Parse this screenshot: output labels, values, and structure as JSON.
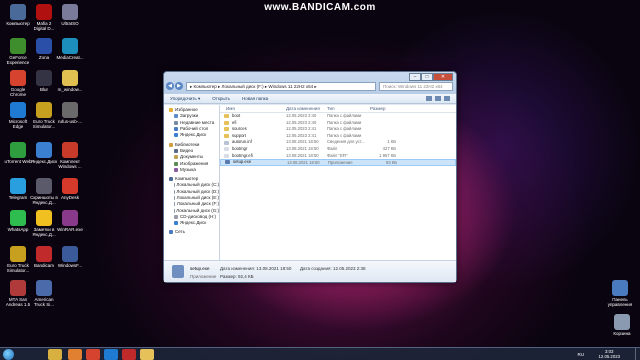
{
  "watermark": "www.BANDICAM.com",
  "desktop_icons_left": [
    {
      "label": "Компьютер",
      "icon": "computer-icon",
      "color": "#4a6a9a"
    },
    {
      "label": "Mafia 2 Digital D...",
      "icon": "game-icon",
      "color": "#b01010"
    },
    {
      "label": "UltraISO",
      "icon": "disc-icon",
      "color": "#7a7a9a"
    },
    {
      "label": "GeForce Experience",
      "icon": "nvidia-icon",
      "color": "#3e8e2e"
    },
    {
      "label": "Zona",
      "icon": "zona-icon",
      "color": "#2a4fa8"
    },
    {
      "label": "MediaCreat...",
      "icon": "media-icon",
      "color": "#1c8fbd"
    },
    {
      "label": "Google Chrome",
      "icon": "chrome-icon",
      "color": "#d6432f"
    },
    {
      "label": "Blur",
      "icon": "game-icon",
      "color": "#333344"
    },
    {
      "label": "m_window...",
      "icon": "folder-icon",
      "color": "#e0c050"
    },
    {
      "label": "Microsoft Edge",
      "icon": "edge-icon",
      "color": "#1f7bd1"
    },
    {
      "label": "Euro Truck Simulator...",
      "icon": "truck-icon",
      "color": "#c8a020"
    },
    {
      "label": "rufus-usb-...",
      "icon": "usb-icon",
      "color": "#6a6a6a"
    },
    {
      "label": "uTorrent Web",
      "icon": "utorrent-icon",
      "color": "#2e9e3e"
    },
    {
      "label": "Яндекс.Диск",
      "icon": "yadisk-icon",
      "color": "#3a7fd0"
    },
    {
      "label": "Комплект Windows ...",
      "icon": "windows-icon",
      "color": "#c83a2a"
    },
    {
      "label": "Telegram",
      "icon": "telegram-icon",
      "color": "#2a9fe0"
    },
    {
      "label": "Скриншоты в Яндекс.Д...",
      "icon": "scissors-icon",
      "color": "#5a5a6a"
    },
    {
      "label": "AnyDesk",
      "icon": "anydesk-icon",
      "color": "#d63a2a"
    },
    {
      "label": "WhatsApp",
      "icon": "whatsapp-icon",
      "color": "#2ebd4e"
    },
    {
      "label": "Заметки в Яндекс.Д...",
      "icon": "notes-icon",
      "color": "#f0c020"
    },
    {
      "label": "WinRAR.exe",
      "icon": "winrar-icon",
      "color": "#8a3a8a"
    },
    {
      "label": "Euro Truck Simulator...",
      "icon": "truck-icon",
      "color": "#c8a020"
    },
    {
      "label": "Bandicam",
      "icon": "bandicam-icon",
      "color": "#c02a2a"
    },
    {
      "label": "WindowsF...",
      "icon": "windows-icon",
      "color": "#3a5a9a"
    },
    {
      "label": "MTA San Andreas 1.5",
      "icon": "mta-icon",
      "color": "#b03a3a"
    },
    {
      "label": "American Truck Si...",
      "icon": "truck-icon",
      "color": "#4a6aaa"
    }
  ],
  "desktop_icons_right": [
    {
      "label": "Панель управления",
      "icon": "control-panel-icon",
      "color": "#4a7ac0"
    },
    {
      "label": "Корзина",
      "icon": "recycle-bin-icon",
      "color": "#8a9ab0"
    }
  ],
  "window": {
    "address": "▸ Компьютер ▸ Локальный диск (F:) ▸ Windows 11 22H2 x64 ▸",
    "search_placeholder": "Поиск: Windows 11 22H2 x64",
    "toolbar": {
      "organize": "Упорядочить ▾",
      "open": "Открыть",
      "new_folder": "Новая папка"
    },
    "columns": {
      "name": "Имя",
      "date": "Дата изменения",
      "type": "Тип",
      "size": "Размер"
    },
    "sidebar": [
      {
        "label": "Избранное",
        "icon": "star-icon",
        "color": "#e8b030",
        "level": 0
      },
      {
        "label": "Загрузки",
        "icon": "downloads-icon",
        "color": "#5a8ad0",
        "level": 1
      },
      {
        "label": "Недавние места",
        "icon": "recent-icon",
        "color": "#7a8aa0",
        "level": 1
      },
      {
        "label": "Рабочий стол",
        "icon": "desktop-icon",
        "color": "#4a7ac0",
        "level": 1
      },
      {
        "label": "Яндекс.Диск",
        "icon": "yadisk-icon",
        "color": "#3a7fd0",
        "level": 1
      },
      {
        "label": "",
        "icon": "",
        "color": "",
        "level": -1
      },
      {
        "label": "Библиотеки",
        "icon": "library-icon",
        "color": "#d0a040",
        "level": 0
      },
      {
        "label": "Видео",
        "icon": "video-icon",
        "color": "#5a6a8a",
        "level": 1
      },
      {
        "label": "Документы",
        "icon": "documents-icon",
        "color": "#c0a050",
        "level": 1
      },
      {
        "label": "Изображения",
        "icon": "pictures-icon",
        "color": "#5a8a5a",
        "level": 1
      },
      {
        "label": "Музыка",
        "icon": "music-icon",
        "color": "#8a5aa0",
        "level": 1
      },
      {
        "label": "",
        "icon": "",
        "color": "",
        "level": -1
      },
      {
        "label": "Компьютер",
        "icon": "computer-icon",
        "color": "#4a6a9a",
        "level": 0
      },
      {
        "label": "Локальный диск (C:)",
        "icon": "drive-icon",
        "color": "#8a9aaa",
        "level": 1
      },
      {
        "label": "Локальный диск (D:)",
        "icon": "drive-icon",
        "color": "#8a9aaa",
        "level": 1
      },
      {
        "label": "Локальный диск (E:)",
        "icon": "drive-icon",
        "color": "#8a9aaa",
        "level": 1
      },
      {
        "label": "Локальный диск (F:)",
        "icon": "drive-icon",
        "color": "#8a9aaa",
        "level": 1
      },
      {
        "label": "Локальный диск (G:)",
        "icon": "drive-icon",
        "color": "#8a9aaa",
        "level": 1
      },
      {
        "label": "CD-дисковод (H:)",
        "icon": "cd-icon",
        "color": "#9a9aaa",
        "level": 1
      },
      {
        "label": "Яндекс.Диск",
        "icon": "yadisk-icon",
        "color": "#3a7fd0",
        "level": 1
      },
      {
        "label": "",
        "icon": "",
        "color": "",
        "level": -1
      },
      {
        "label": "Сеть",
        "icon": "network-icon",
        "color": "#4a7ac0",
        "level": 0
      }
    ],
    "files": [
      {
        "name": "boot",
        "date": "12.05.2023 2:40",
        "type": "Папка с файлами",
        "size": "",
        "icon": "folder-icon",
        "color": "#e6c15a",
        "selected": false
      },
      {
        "name": "efi",
        "date": "12.05.2023 2:40",
        "type": "Папка с файлами",
        "size": "",
        "icon": "folder-icon",
        "color": "#e6c15a",
        "selected": false
      },
      {
        "name": "sources",
        "date": "12.05.2023 2:41",
        "type": "Папка с файлами",
        "size": "",
        "icon": "folder-icon",
        "color": "#e6c15a",
        "selected": false
      },
      {
        "name": "support",
        "date": "12.05.2023 2:41",
        "type": "Папка с файлами",
        "size": "",
        "icon": "folder-icon",
        "color": "#e6c15a",
        "selected": false
      },
      {
        "name": "autorun.inf",
        "date": "13.08.2021 18:50",
        "type": "Сведения для уст...",
        "size": "1 КБ",
        "icon": "file-icon",
        "color": "#b8c4d4",
        "selected": false
      },
      {
        "name": "bootmgr",
        "date": "13.08.2021 18:50",
        "type": "Файл",
        "size": "427 КБ",
        "icon": "file-icon",
        "color": "#d8dce4",
        "selected": false
      },
      {
        "name": "bootmgr.efi",
        "date": "13.08.2021 18:50",
        "type": "Файл \"EFI\"",
        "size": "1 957 КБ",
        "icon": "file-icon",
        "color": "#d8dce4",
        "selected": false
      },
      {
        "name": "setup.exe",
        "date": "13.08.2021 18:50",
        "type": "Приложение",
        "size": "93 КБ",
        "icon": "setup-icon",
        "color": "#5a7ab0",
        "selected": true
      }
    ],
    "details": {
      "name": "setup.exe",
      "type": "Приложение",
      "modified": "Дата изменения: 13.08.2021 18:50",
      "size": "Размер: 92,4 КБ",
      "created": "Дата создания: 12.05.2023 2:38"
    }
  },
  "taskbar": {
    "apps": [
      {
        "icon": "explorer-icon",
        "color": "#d8b040"
      },
      {
        "icon": "media-player-icon",
        "color": "#e08030"
      },
      {
        "icon": "chrome-icon",
        "color": "#d6432f"
      },
      {
        "icon": "edge-icon",
        "color": "#1f7bd1"
      },
      {
        "icon": "bandicam-icon",
        "color": "#c02a2a"
      },
      {
        "icon": "folder-window-icon",
        "color": "#e6c15a"
      }
    ],
    "lang": "RU",
    "time": "3:03",
    "date": "12.05.2023"
  }
}
